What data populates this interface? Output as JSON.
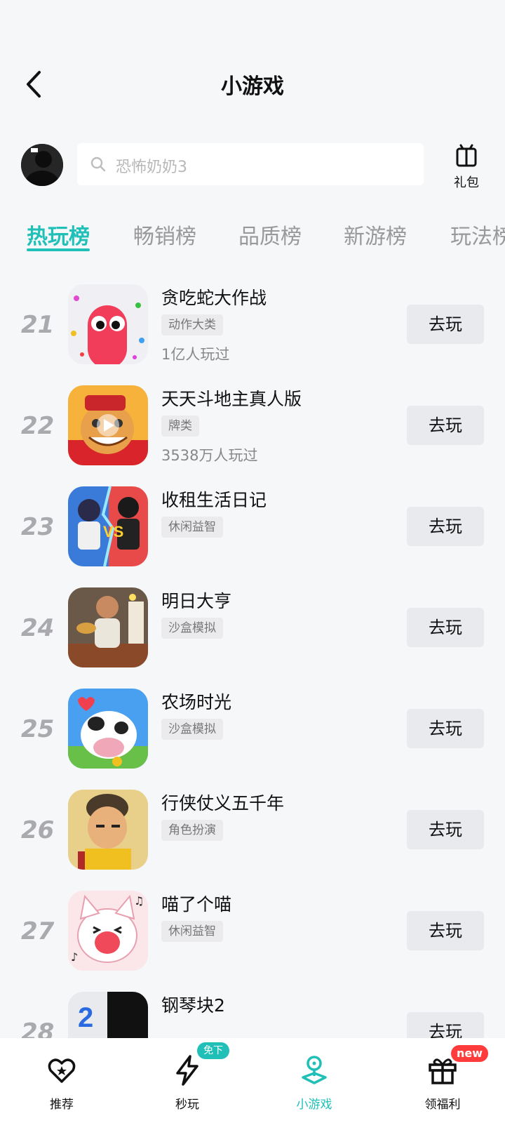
{
  "header": {
    "title": "小游戏"
  },
  "search": {
    "placeholder": "恐怖奶奶3",
    "gift_label": "礼包"
  },
  "tabs": [
    {
      "label": "热玩榜",
      "active": true
    },
    {
      "label": "畅销榜",
      "active": false
    },
    {
      "label": "品质榜",
      "active": false
    },
    {
      "label": "新游榜",
      "active": false
    },
    {
      "label": "玩法榜",
      "active": false
    }
  ],
  "games": [
    {
      "rank": "21",
      "name": "贪吃蛇大作战",
      "tag": "动作大类",
      "plays": "1亿人玩过",
      "button": "去玩"
    },
    {
      "rank": "22",
      "name": "天天斗地主真人版",
      "tag": "牌类",
      "plays": "3538万人玩过",
      "button": "去玩"
    },
    {
      "rank": "23",
      "name": "收租生活日记",
      "tag": "休闲益智",
      "plays": "",
      "button": "去玩"
    },
    {
      "rank": "24",
      "name": "明日大亨",
      "tag": "沙盒模拟",
      "plays": "",
      "button": "去玩"
    },
    {
      "rank": "25",
      "name": "农场时光",
      "tag": "沙盒模拟",
      "plays": "",
      "button": "去玩"
    },
    {
      "rank": "26",
      "name": "行侠仗义五千年",
      "tag": "角色扮演",
      "plays": "",
      "button": "去玩"
    },
    {
      "rank": "27",
      "name": "喵了个喵",
      "tag": "休闲益智",
      "plays": "",
      "button": "去玩"
    },
    {
      "rank": "28",
      "name": "钢琴块2",
      "tag": "",
      "plays": "",
      "button": "去玩"
    }
  ],
  "bottom_nav": [
    {
      "label": "推荐",
      "active": false,
      "badge": ""
    },
    {
      "label": "秒玩",
      "active": false,
      "badge": "免下载"
    },
    {
      "label": "小游戏",
      "active": true,
      "badge": ""
    },
    {
      "label": "领福利",
      "active": false,
      "badge": "new"
    }
  ],
  "colors": {
    "accent": "#20c0b8",
    "badge_red": "#ff3b3b",
    "badge_teal": "#20c0b8"
  }
}
